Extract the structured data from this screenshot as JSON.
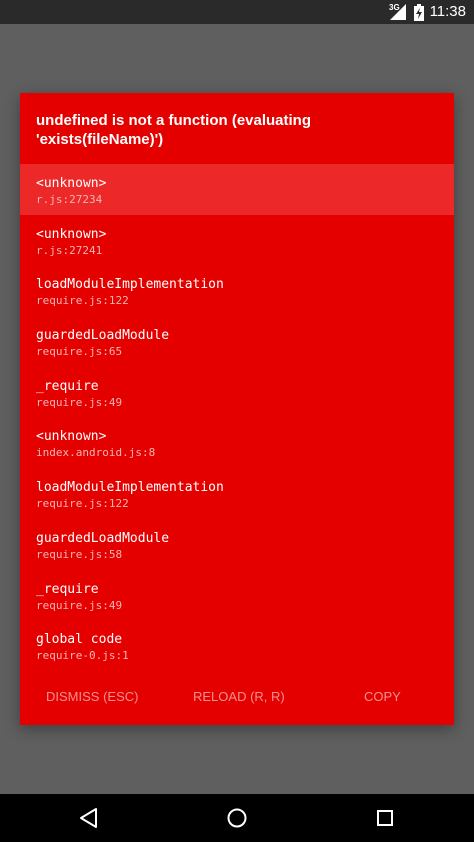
{
  "status_bar": {
    "network": "3G",
    "time": "11:38"
  },
  "dialog": {
    "title": "undefined is not a function (evaluating 'exists(fileName)')",
    "frames": [
      {
        "method": "<unknown>",
        "location": "r.js:27234",
        "selected": true
      },
      {
        "method": "<unknown>",
        "location": "r.js:27241"
      },
      {
        "method": "loadModuleImplementation",
        "location": "require.js:122"
      },
      {
        "method": "guardedLoadModule",
        "location": "require.js:65"
      },
      {
        "method": "_require",
        "location": "require.js:49"
      },
      {
        "method": "<unknown>",
        "location": "index.android.js:8"
      },
      {
        "method": "loadModuleImplementation",
        "location": "require.js:122"
      },
      {
        "method": "guardedLoadModule",
        "location": "require.js:58"
      },
      {
        "method": "_require",
        "location": "require.js:49"
      },
      {
        "method": "global code",
        "location": "require-0.js:1"
      }
    ],
    "actions": {
      "dismiss": "DISMISS (ESC)",
      "reload": "RELOAD (R, R)",
      "copy": "COPY"
    }
  },
  "nav_bar": {
    "icons": [
      "back-icon",
      "home-icon",
      "recents-icon"
    ]
  },
  "colors": {
    "dialog_background": "#e50000",
    "selected_row": "#ec2828",
    "scrim": "#5f5f5f",
    "action_text": "#f49090"
  }
}
